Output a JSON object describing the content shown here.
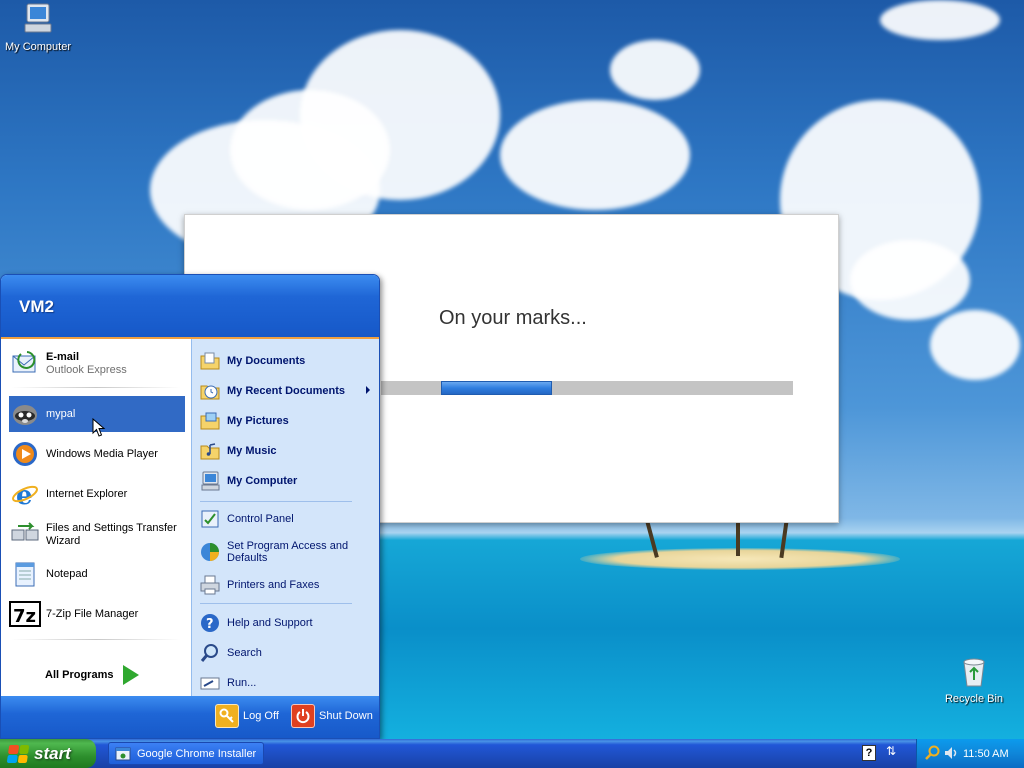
{
  "desktop": {
    "icons": [
      {
        "label": "My Computer",
        "icon": "my-computer-icon"
      },
      {
        "label": "Recycle Bin",
        "icon": "recycle-bin-icon"
      }
    ]
  },
  "installer": {
    "message": "On your marks...",
    "progress_fraction": 0.27
  },
  "start_menu": {
    "user": "VM2",
    "pinned": [
      {
        "title": "E-mail",
        "subtitle": "Outlook Express",
        "icon": "email-icon"
      }
    ],
    "recent": [
      {
        "title": "mypal",
        "icon": "mypal-icon",
        "highlighted": true
      },
      {
        "title": "Windows Media Player",
        "icon": "media-player-icon"
      },
      {
        "title": "Internet Explorer",
        "icon": "internet-explorer-icon"
      },
      {
        "title": "Files and Settings Transfer Wizard",
        "icon": "transfer-wizard-icon"
      },
      {
        "title": "Notepad",
        "icon": "notepad-icon"
      },
      {
        "title": "7-Zip File Manager",
        "icon": "7zip-icon"
      }
    ],
    "all_programs": "All Programs",
    "places": [
      {
        "label": "My Documents",
        "icon": "folder-documents-icon",
        "bold": true
      },
      {
        "label": "My Recent Documents",
        "icon": "recent-documents-icon",
        "bold": true,
        "submenu": true
      },
      {
        "label": "My Pictures",
        "icon": "folder-pictures-icon",
        "bold": true
      },
      {
        "label": "My Music",
        "icon": "folder-music-icon",
        "bold": true
      },
      {
        "label": "My Computer",
        "icon": "my-computer-icon",
        "bold": true
      }
    ],
    "settings": [
      {
        "label": "Control Panel",
        "icon": "control-panel-icon"
      },
      {
        "label": "Set Program Access and Defaults",
        "icon": "program-access-icon"
      },
      {
        "label": "Printers and Faxes",
        "icon": "printer-icon"
      }
    ],
    "tools": [
      {
        "label": "Help and Support",
        "icon": "help-icon"
      },
      {
        "label": "Search",
        "icon": "search-icon"
      },
      {
        "label": "Run...",
        "icon": "run-icon"
      }
    ],
    "footer": {
      "log_off": "Log Off",
      "shut_down": "Shut Down"
    }
  },
  "taskbar": {
    "start_label": "start",
    "tasks": [
      {
        "label": "Google Chrome Installer",
        "icon": "chrome-installer-icon"
      }
    ],
    "clock": "11:50 AM"
  },
  "colors": {
    "start_green": "#2d8f2d",
    "taskbar_blue": "#1f5fd9",
    "highlight": "#316ac5",
    "progress_fill": "#2f7ee0"
  }
}
